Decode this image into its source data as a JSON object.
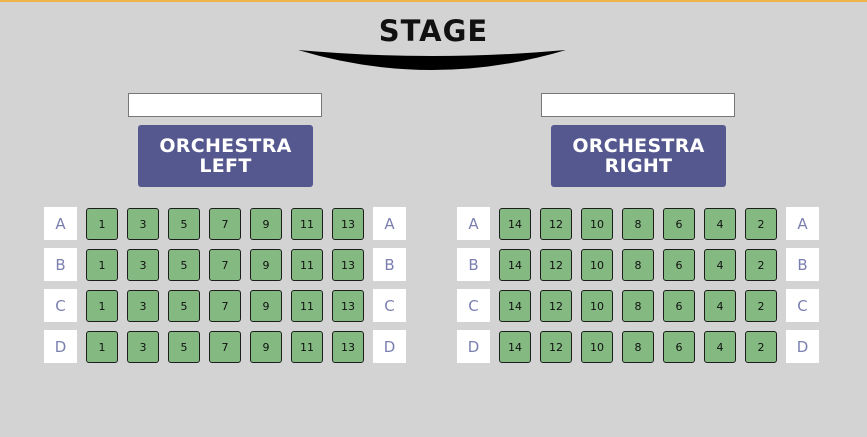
{
  "stage": {
    "title": "STAGE"
  },
  "sections": [
    {
      "id": "left",
      "input_value": "",
      "name_line1": "ORCHESTRA",
      "name_line2": "LEFT",
      "rows": [
        {
          "label": "A",
          "seats": [
            "1",
            "3",
            "5",
            "7",
            "9",
            "11",
            "13"
          ]
        },
        {
          "label": "B",
          "seats": [
            "1",
            "3",
            "5",
            "7",
            "9",
            "11",
            "13"
          ]
        },
        {
          "label": "C",
          "seats": [
            "1",
            "3",
            "5",
            "7",
            "9",
            "11",
            "13"
          ]
        },
        {
          "label": "D",
          "seats": [
            "1",
            "3",
            "5",
            "7",
            "9",
            "11",
            "13"
          ]
        }
      ]
    },
    {
      "id": "right",
      "input_value": "",
      "name_line1": "ORCHESTRA",
      "name_line2": "RIGHT",
      "rows": [
        {
          "label": "A",
          "seats": [
            "14",
            "12",
            "10",
            "8",
            "6",
            "4",
            "2"
          ]
        },
        {
          "label": "B",
          "seats": [
            "14",
            "12",
            "10",
            "8",
            "6",
            "4",
            "2"
          ]
        },
        {
          "label": "C",
          "seats": [
            "14",
            "12",
            "10",
            "8",
            "6",
            "4",
            "2"
          ]
        },
        {
          "label": "D",
          "seats": [
            "14",
            "12",
            "10",
            "8",
            "6",
            "4",
            "2"
          ]
        }
      ]
    }
  ],
  "colors": {
    "background": "#d3d3d3",
    "seat_available": "#84b982",
    "section_header": "#55588f",
    "row_label_text": "#7a7fb0"
  }
}
